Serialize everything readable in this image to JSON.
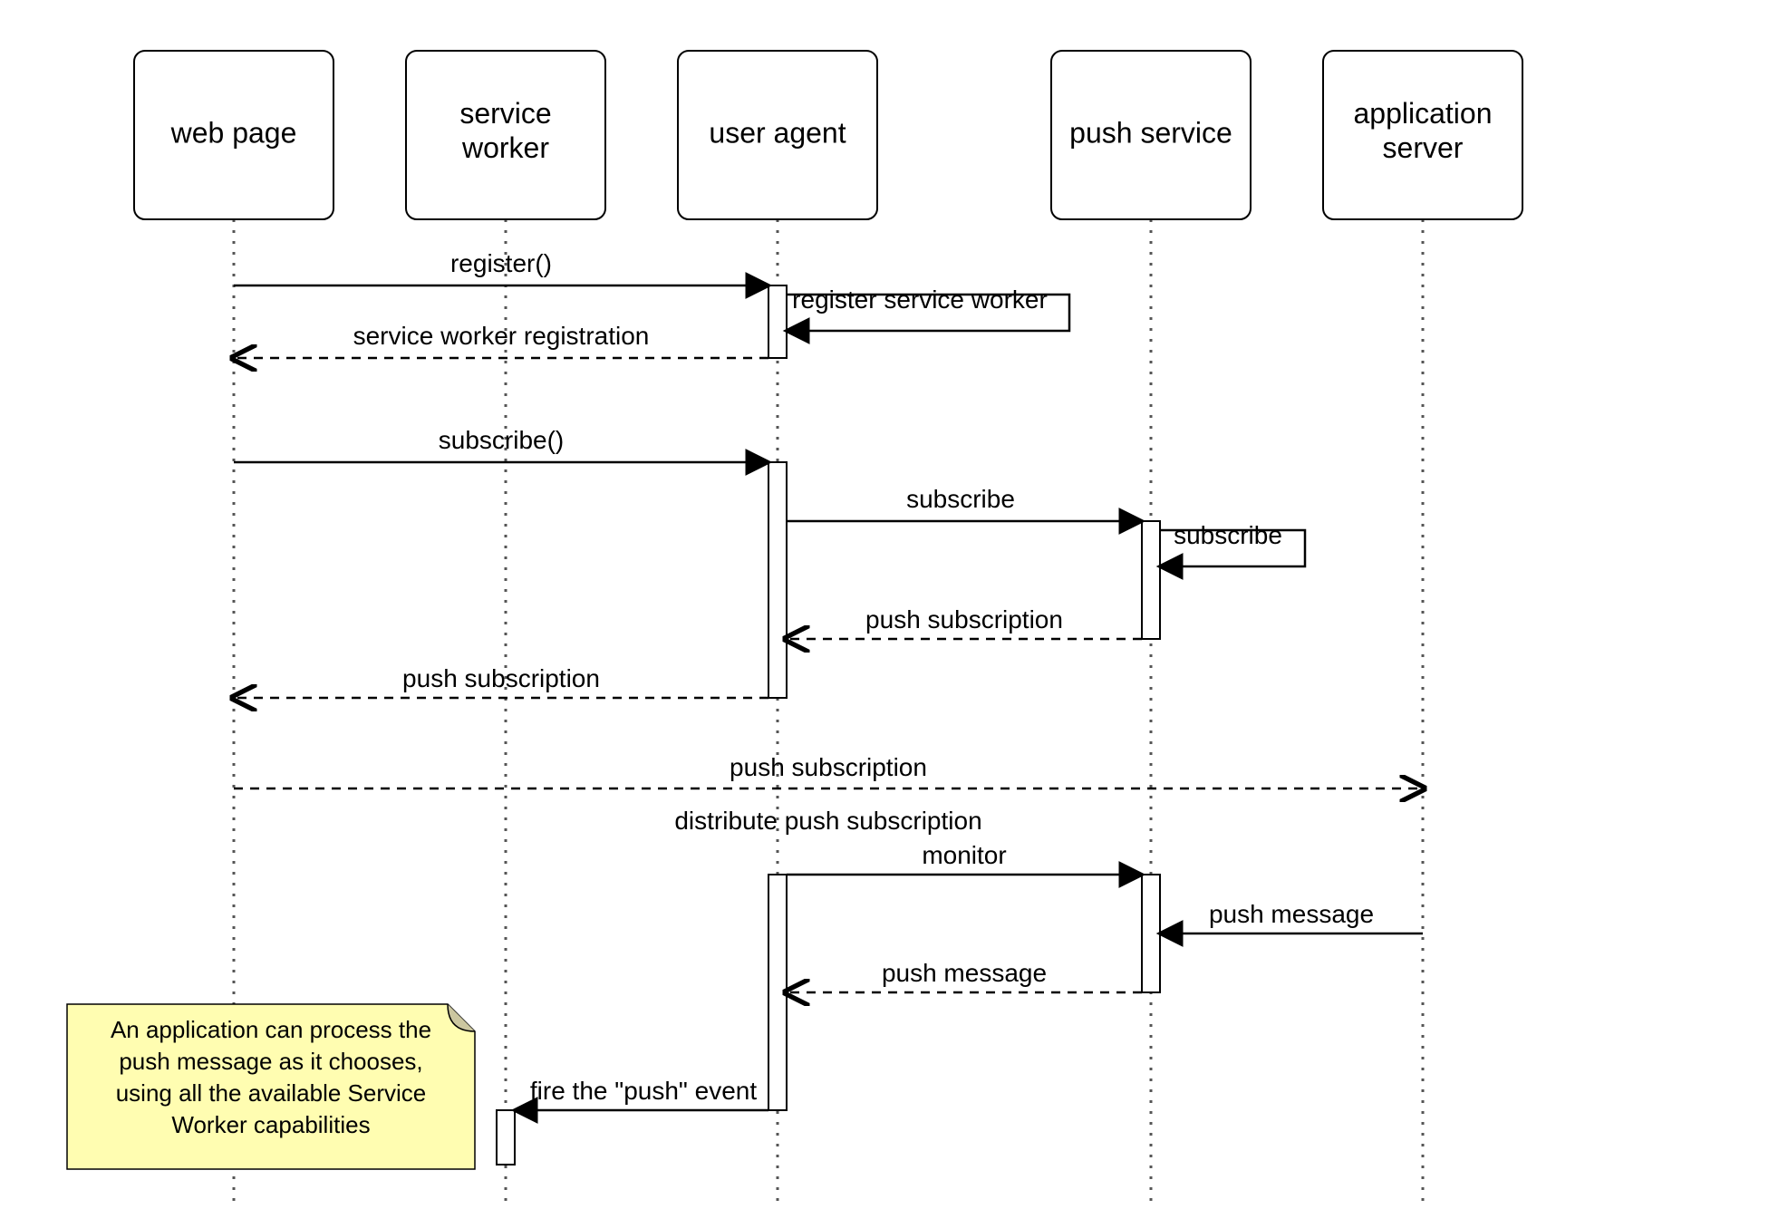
{
  "actors": {
    "web_page": "web page",
    "service_worker": "service worker",
    "user_agent": "user agent",
    "push_service": "push service",
    "application_server": "application server"
  },
  "messages": {
    "m0": "register()",
    "m1": "register service worker",
    "m2": "service worker registration",
    "m3": "subscribe()",
    "m4": "subscribe",
    "m5": "subscribe",
    "m6": "push subscription",
    "m7": "push subscription",
    "m8": "push subscription",
    "m9": "distribute push subscription",
    "m10": "monitor",
    "m11": "push message",
    "m12": "push message",
    "m13": "fire the \"push\" event"
  },
  "note": {
    "line1": "An application can process the",
    "line2": "push message as it chooses,",
    "line3": "using all the available Service",
    "line4": "Worker capabilities"
  }
}
